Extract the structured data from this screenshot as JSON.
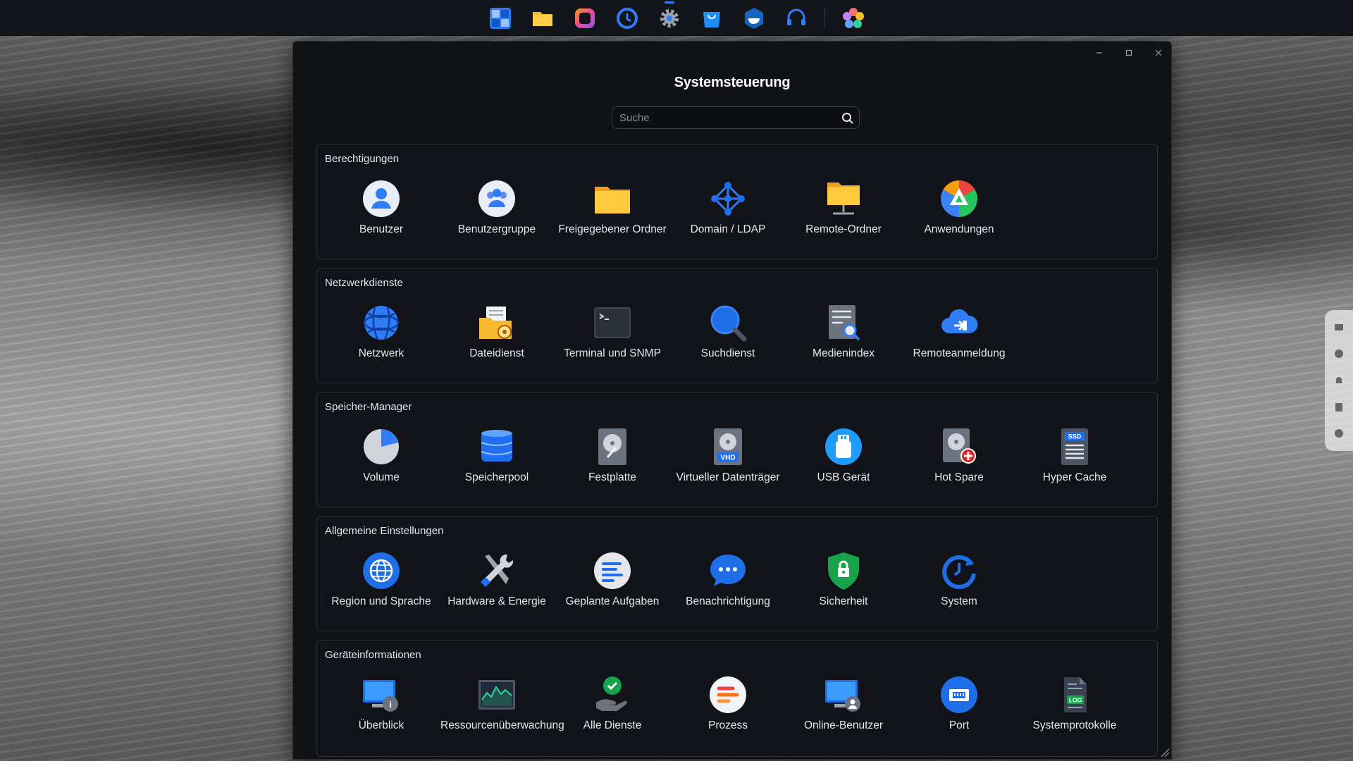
{
  "taskbar": {
    "apps": [
      {
        "icon": "main-menu-icon"
      },
      {
        "icon": "file-station-icon"
      },
      {
        "icon": "photo-app-icon"
      },
      {
        "icon": "backup-clock-icon"
      },
      {
        "icon": "control-panel-icon"
      },
      {
        "icon": "app-center-icon"
      },
      {
        "icon": "docker-icon"
      },
      {
        "icon": "support-headset-icon"
      },
      {
        "icon": "photos-flower-icon"
      }
    ]
  },
  "window": {
    "title": "Systemsteuerung",
    "search": {
      "placeholder": "Suche",
      "value": ""
    }
  },
  "sections": [
    {
      "title": "Berechtigungen",
      "items": [
        {
          "label": "Benutzer",
          "icon": "user-icon"
        },
        {
          "label": "Benutzergruppe",
          "icon": "user-group-icon"
        },
        {
          "label": "Freigegebener Ordner",
          "icon": "shared-folder-icon"
        },
        {
          "label": "Domain / LDAP",
          "icon": "domain-ldap-icon"
        },
        {
          "label": "Remote-Ordner",
          "icon": "remote-folder-icon"
        },
        {
          "label": "Anwendungen",
          "icon": "applications-icon"
        }
      ]
    },
    {
      "title": "Netzwerkdienste",
      "items": [
        {
          "label": "Netzwerk",
          "icon": "network-globe-icon"
        },
        {
          "label": "Dateidienst",
          "icon": "file-service-icon"
        },
        {
          "label": "Terminal und SNMP",
          "icon": "terminal-icon"
        },
        {
          "label": "Suchdienst",
          "icon": "search-service-icon"
        },
        {
          "label": "Medienindex",
          "icon": "media-index-icon"
        },
        {
          "label": "Remoteanmeldung",
          "icon": "remote-login-icon"
        }
      ]
    },
    {
      "title": "Speicher-Manager",
      "items": [
        {
          "label": "Volume",
          "icon": "volume-pie-icon"
        },
        {
          "label": "Speicherpool",
          "icon": "storage-pool-icon"
        },
        {
          "label": "Festplatte",
          "icon": "hard-disk-icon"
        },
        {
          "label": "Virtueller Datenträger",
          "icon": "virtual-disk-vhd-icon",
          "badge": "VHD"
        },
        {
          "label": "USB Gerät",
          "icon": "usb-device-icon"
        },
        {
          "label": "Hot Spare",
          "icon": "hot-spare-icon"
        },
        {
          "label": "Hyper Cache",
          "icon": "ssd-cache-icon",
          "badge": "SSD"
        }
      ]
    },
    {
      "title": "Allgemeine Einstellungen",
      "items": [
        {
          "label": "Region und Sprache",
          "icon": "region-globe-icon"
        },
        {
          "label": "Hardware & Energie",
          "icon": "hardware-tools-icon"
        },
        {
          "label": "Geplante Aufgaben",
          "icon": "scheduled-tasks-icon"
        },
        {
          "label": "Benachrichtigung",
          "icon": "notification-chat-icon"
        },
        {
          "label": "Sicherheit",
          "icon": "security-shield-icon"
        },
        {
          "label": "System",
          "icon": "system-clock-icon"
        }
      ]
    },
    {
      "title": "Geräteinformationen",
      "items": [
        {
          "label": "Überblick",
          "icon": "overview-monitor-icon"
        },
        {
          "label": "Ressourcenüberwachung",
          "icon": "resource-monitor-icon"
        },
        {
          "label": "Alle Dienste",
          "icon": "all-services-icon"
        },
        {
          "label": "Prozess",
          "icon": "process-icon"
        },
        {
          "label": "Online-Benutzer",
          "icon": "online-users-icon"
        },
        {
          "label": "Port",
          "icon": "port-icon"
        },
        {
          "label": "Systemprotokolle",
          "icon": "system-log-icon",
          "badge": "LOG"
        }
      ]
    }
  ],
  "colors": {
    "window_bg": "#101216",
    "taskbar_bg": "#121519",
    "accent_blue": "#2f7cf6",
    "folder_yellow": "#f5b82e"
  }
}
